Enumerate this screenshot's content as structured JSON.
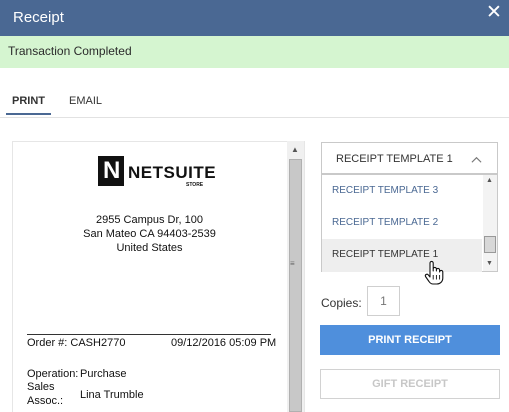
{
  "window": {
    "title": "Receipt",
    "close_icon": "close-icon"
  },
  "notice": {
    "text": "Transaction Completed",
    "color": "#d5f5d0"
  },
  "tabs": [
    {
      "label": "PRINT",
      "active": true
    },
    {
      "label": "EMAIL",
      "active": false
    }
  ],
  "receipt": {
    "logo": {
      "mark": "N",
      "name": "NETSUITE",
      "sub": "STORE"
    },
    "address": [
      "2955 Campus Dr, 100",
      "San Mateo CA 94403-2539",
      "United States"
    ],
    "order_label": "Order #: CASH2770",
    "order_date": "09/12/2016 05:09 PM",
    "operation_label": "Operation:",
    "operation_value": "Purchase",
    "sales_assoc_label_1": "Sales",
    "sales_assoc_label_2": "Assoc.:",
    "sales_assoc_value": "Lina Trumble"
  },
  "template_select": {
    "selected": "RECEIPT TEMPLATE 1",
    "options": [
      "RECEIPT TEMPLATE 3",
      "RECEIPT TEMPLATE 2",
      "RECEIPT TEMPLATE 1"
    ]
  },
  "copies": {
    "label": "Copies:",
    "placeholder": "1"
  },
  "buttons": {
    "print": "PRINT RECEIPT",
    "gift": "GIFT RECEIPT"
  },
  "colors": {
    "titlebar": "#4a6893",
    "primary": "#4f8fdc"
  }
}
